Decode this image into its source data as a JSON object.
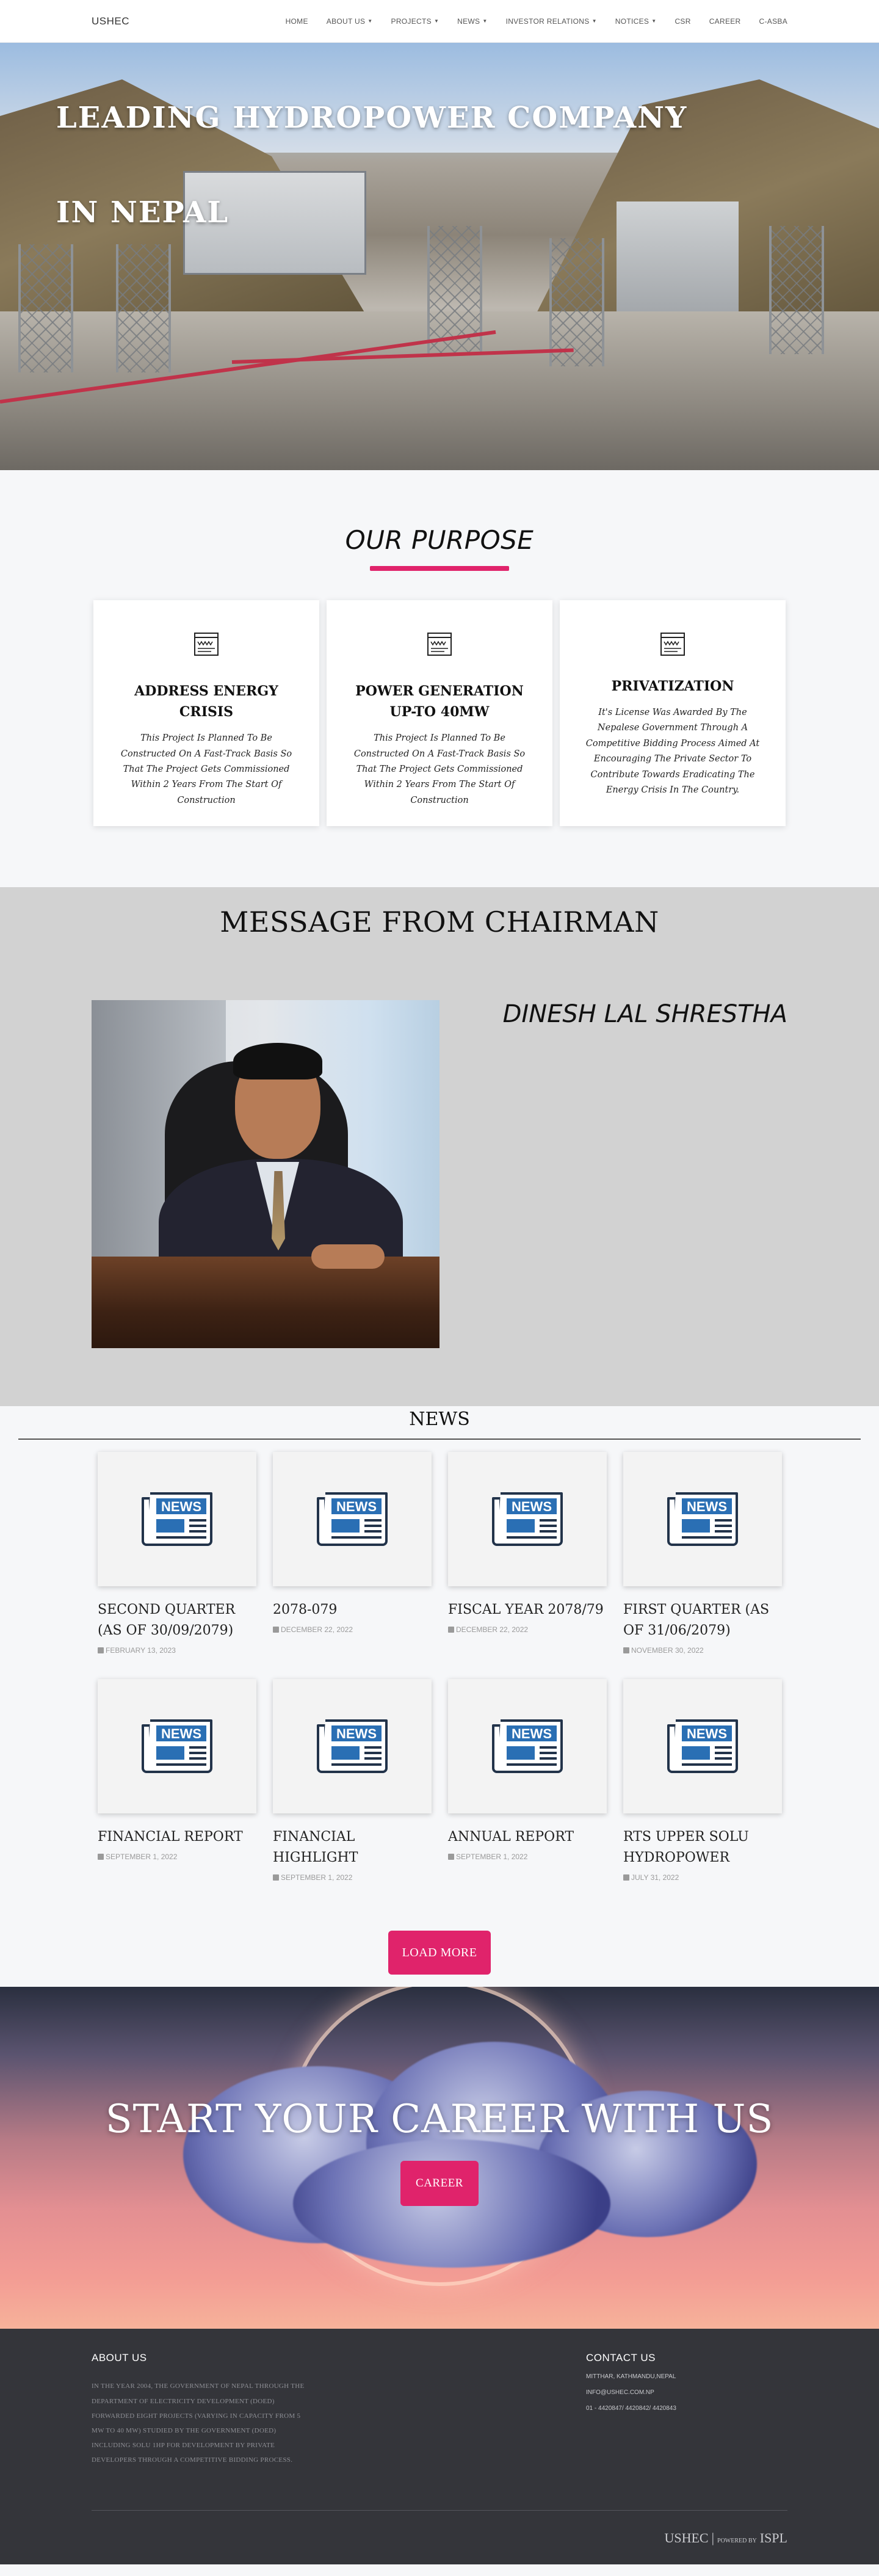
{
  "nav": {
    "brand": "USHEC",
    "items": [
      {
        "label": "HOME",
        "dropdown": false
      },
      {
        "label": "ABOUT US",
        "dropdown": true
      },
      {
        "label": "PROJECTS",
        "dropdown": true
      },
      {
        "label": "NEWS",
        "dropdown": true
      },
      {
        "label": "INVESTOR RELATIONS",
        "dropdown": true
      },
      {
        "label": "NOTICES",
        "dropdown": true
      },
      {
        "label": "CSR",
        "dropdown": false
      },
      {
        "label": "CAREER",
        "dropdown": false
      },
      {
        "label": "C-ASBA",
        "dropdown": false
      }
    ]
  },
  "hero": {
    "line1": "LEADING HYDROPOWER COMPANY",
    "line2": "IN NEPAL"
  },
  "purpose": {
    "title": "OUR PURPOSE",
    "cards": [
      {
        "icon": "document-icon",
        "title": "ADDRESS ENERGY CRISIS",
        "text": "This Project Is Planned To Be Constructed On A Fast-Track Basis So That The Project Gets Commissioned Within 2 Years From The Start Of Construction"
      },
      {
        "icon": "document-icon",
        "title": "POWER GENERATION UP-TO 40MW",
        "text": "This Project Is Planned To Be Constructed On A Fast-Track Basis So That The Project Gets Commissioned Within 2 Years From The Start Of Construction"
      },
      {
        "icon": "document-icon",
        "title": "PRIVATIZATION",
        "text": "It's License Was Awarded By The Nepalese Government Through A Competitive Bidding Process Aimed At Encouraging The Private Sector To Contribute Towards Eradicating The Energy Crisis In The Country."
      }
    ]
  },
  "chairman": {
    "title": "MESSAGE FROM CHAIRMAN",
    "name": "DINESH LAL SHRESTHA"
  },
  "news": {
    "title": "NEWS",
    "items": [
      {
        "title": "SECOND QUARTER (AS OF 30/09/2079)",
        "date": "FEBRUARY 13, 2023"
      },
      {
        "title": "2078-079",
        "date": "DECEMBER 22, 2022"
      },
      {
        "title": "FISCAL YEAR 2078/79",
        "date": "DECEMBER 22, 2022"
      },
      {
        "title": "FIRST QUARTER (AS OF 31/06/2079)",
        "date": "NOVEMBER 30, 2022"
      },
      {
        "title": "FINANCIAL REPORT",
        "date": "SEPTEMBER 1, 2022"
      },
      {
        "title": "FINANCIAL HIGHLIGHT",
        "date": "SEPTEMBER 1, 2022"
      },
      {
        "title": "ANNUAL REPORT",
        "date": "SEPTEMBER 1, 2022"
      },
      {
        "title": "RTS UPPER SOLU HYDROPOWER",
        "date": "JULY 31, 2022"
      }
    ],
    "thumb_label": "NEWS",
    "load_more": "LOAD MORE"
  },
  "career": {
    "title": "START YOUR CAREER WITH US",
    "button": "CAREER"
  },
  "footer": {
    "about_title": "ABOUT US",
    "about_text": "IN THE YEAR 2004, THE GOVERNMENT OF NEPAL THROUGH THE DEPARTMENT OF ELECTRICITY DEVELOPMENT (DOED) FORWARDED EIGHT PROJECTS (VARYING IN CAPACITY FROM 5 MW TO 40 MW) STUDIED BY THE GOVERNMENT (DOED) INCLUDING SOLU 1HP FOR DEVELOPMENT BY PRIVATE DEVELOPERS THROUGH A COMPETITIVE BIDDING PROCESS.",
    "contact_title": "CONTACT US",
    "contact_lines": [
      "MITTHAR, KATHMANDU,NEPAL",
      "INFO@USHEC.COM.NP",
      "01 - 4420847/ 4420842/ 4420843"
    ],
    "copyright_brand": "USHEC",
    "powered_by": "POWERED BY",
    "powered_brand": "ISPL"
  },
  "colors": {
    "accent": "#e0236b",
    "footer_bg": "#34353a",
    "chairman_bg": "#d2d2d2",
    "news_icon": "#2a6fb4"
  }
}
